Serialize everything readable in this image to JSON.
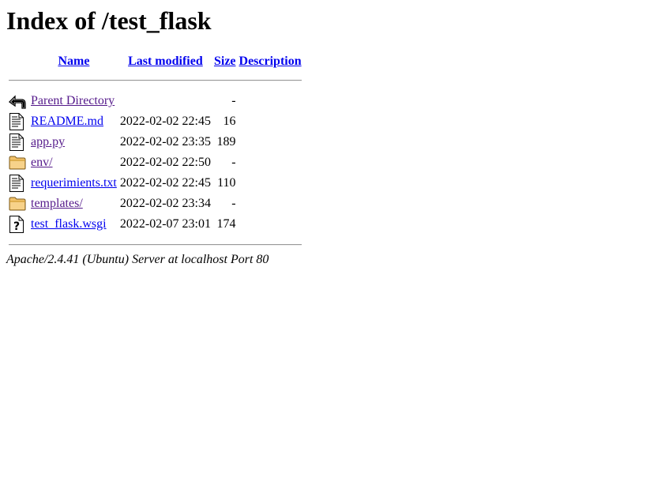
{
  "page": {
    "title": "Index of /test_flask"
  },
  "columns": {
    "name": "Name",
    "last_modified": "Last modified",
    "size": "Size",
    "description": "Description"
  },
  "rows": [
    {
      "icon": "back-icon",
      "name": "Parent Directory",
      "modified": "",
      "size": "-",
      "description": "",
      "visited": true
    },
    {
      "icon": "text-file-icon",
      "name": "README.md",
      "modified": "2022-02-02 22:45",
      "size": "16",
      "description": "",
      "visited": false
    },
    {
      "icon": "text-file-icon",
      "name": "app.py",
      "modified": "2022-02-02 23:35",
      "size": "189",
      "description": "",
      "visited": true
    },
    {
      "icon": "folder-icon",
      "name": "env/",
      "modified": "2022-02-02 22:50",
      "size": "-",
      "description": "",
      "visited": true
    },
    {
      "icon": "text-file-icon",
      "name": "requerimients.txt",
      "modified": "2022-02-02 22:45",
      "size": "110",
      "description": "",
      "visited": false
    },
    {
      "icon": "folder-icon",
      "name": "templates/",
      "modified": "2022-02-02 23:34",
      "size": "-",
      "description": "",
      "visited": true
    },
    {
      "icon": "unknown-file-icon",
      "name": "test_flask.wsgi",
      "modified": "2022-02-07 23:01",
      "size": "174",
      "description": "",
      "visited": false
    }
  ],
  "footer": {
    "address": "Apache/2.4.41 (Ubuntu) Server at localhost Port 80"
  },
  "colors": {
    "link": "#0000ee",
    "visited": "#551a8b"
  }
}
